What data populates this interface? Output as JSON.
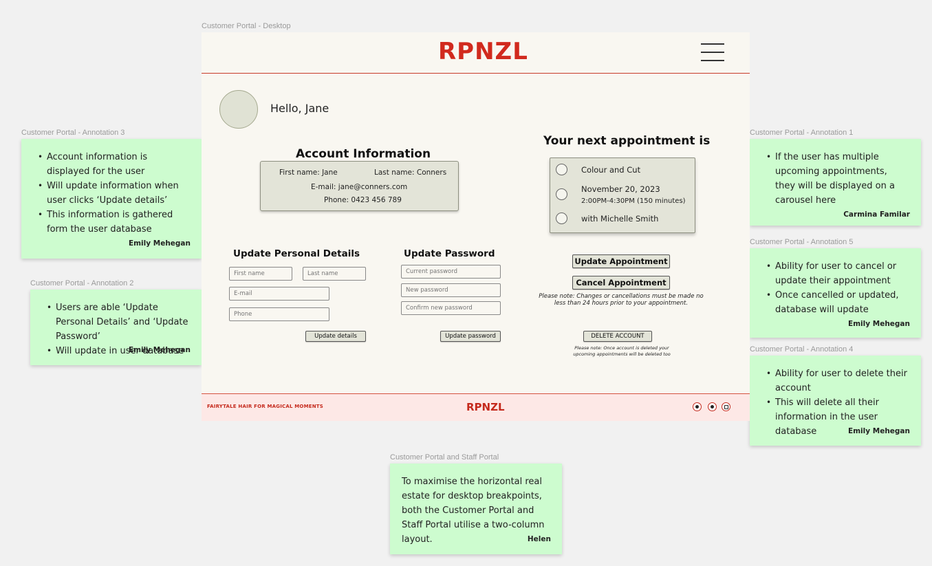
{
  "frames": {
    "desktop": "Customer Portal - Desktop",
    "annotation3": "Customer Portal - Annotation 3",
    "annotation2": "Customer Portal - Annotation 2",
    "annotation1": "Customer Portal - Annotation 1",
    "annotation5": "Customer Portal - Annotation 5",
    "annotation4": "Customer Portal - Annotation 4",
    "portals": "Customer Portal and Staff Portal"
  },
  "notes": {
    "annotation3": {
      "items": [
        "Account information is displayed for the user",
        "Will update information when user clicks ‘Update details’",
        "This information is gathered form the user database"
      ],
      "author": "Emily Mehegan"
    },
    "annotation2": {
      "items": [
        "Users are able ‘Update Personal Details’ and ‘Update Password’",
        "Will update in user database"
      ],
      "author": "Emily Mehegan"
    },
    "annotation1": {
      "items": [
        "If the user has multiple upcoming appointments, they will be displayed on a carousel here"
      ],
      "author": "Carmina Familar"
    },
    "annotation5": {
      "items": [
        "Ability for user to cancel or update their appointment",
        "Once cancelled or updated, database will update"
      ],
      "author": "Emily Mehegan"
    },
    "annotation4": {
      "items": [
        "Ability for user to delete their account",
        "This will delete all their information in the user database"
      ],
      "author": "Emily Mehegan"
    },
    "portals": {
      "text": "To maximise the horizontal real estate for desktop breakpoints, both the Customer Portal and Staff Portal utilise a two-column layout.",
      "author": "Helen"
    }
  },
  "app": {
    "logo": "RPNZL",
    "greeting": "Hello, Jane",
    "account": {
      "title": "Account Information",
      "first_name": "First name: Jane",
      "last_name": "Last name: Conners",
      "email": "E-mail: jane@conners.com",
      "phone": "Phone: 0423 456 789"
    },
    "appointment": {
      "title": "Your next appointment is",
      "service": "Colour and Cut",
      "date": "November 20, 2023",
      "time": "2:00PM-4:30PM (150 minutes)",
      "stylist": "with Michelle Smith",
      "update_button": "Update Appointment",
      "cancel_button": "Cancel Appointment",
      "notice": "Please note: Changes or cancellations must be made no less than 24 hours prior to your appointment.",
      "delete_button": "DELETE ACCOUNT",
      "delete_notice": "Please note: Once account is deleted your upcoming appointments will be deleted too"
    },
    "personal": {
      "title": "Update Personal Details",
      "first_name_placeholder": "First name",
      "last_name_placeholder": "Last name",
      "email_placeholder": "E-mail",
      "phone_placeholder": "Phone",
      "button": "Update details"
    },
    "password": {
      "title": "Update Password",
      "current_placeholder": "Current password",
      "new_placeholder": "New password",
      "confirm_placeholder": "Confirm new password",
      "button": "Update password"
    },
    "footer": {
      "tagline": "FAIRYTALE HAIR FOR MAGICAL MOMENTS",
      "logo": "RPNZL",
      "social_icons": [
        "threads-icon",
        "facebook-icon",
        "instagram-icon"
      ]
    }
  }
}
